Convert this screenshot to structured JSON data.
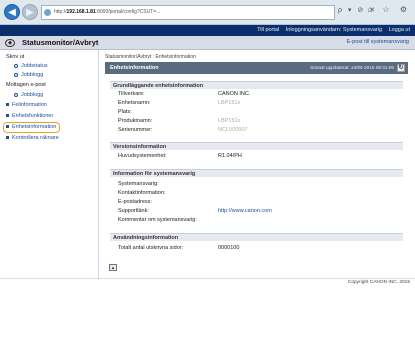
{
  "browser": {
    "url_host": "192.168.1.81",
    "url_rest": ":8000/portal/config?CSUT=...",
    "tools": "ρ ▾ ⊘ ✕",
    "window_tools": "⌂ ☆ ⚙"
  },
  "topbar": {
    "portal": "Till portal",
    "logged_in": "Inloggningsanvändarn: Systemansvarig",
    "logout": "Logga ut"
  },
  "titlebar": {
    "title": "Statusmonitor/Avbryt",
    "mail_link": "E-post till systemansvarig"
  },
  "nav": {
    "section_print": "Skriv ut",
    "job_status": "Jobbstatus",
    "job_log": "Jobblogg",
    "section_email": "Mottagen e-post",
    "email_job_log": "Jobblogg",
    "error_info": "Felinformation",
    "device_functions": "Enhetsfunktioner",
    "device_info": "Enhetsinformation",
    "check_counter": "Kontrollera räknare"
  },
  "main": {
    "breadcrumb": "Statusmonitor/Avbryt : Enhetsinformation",
    "header": "Enhetsinformation",
    "updated": "Senast uppdaterat: 24/06 2015 08:31:06",
    "sections": {
      "basic": "Grundläggande enhetsinformation",
      "version": "Versionsinformation",
      "admin": "Information för systemansvarig",
      "usage": "Användningsinformation"
    },
    "basic_rows": {
      "manufacturer_label": "Tillverkare:",
      "manufacturer_value": "CANON INC.",
      "device_name_label": "Enhetsnamn:",
      "device_name_value": "LBP151x",
      "location_label": "Plats:",
      "product_name_label": "Produktnamn:",
      "product_name_value": "LBP151x",
      "serial_label": "Serienummer:",
      "serial_value": "NCLV00007"
    },
    "version_rows": {
      "main_unit_label": "Huvudsystemenhet:",
      "main_unit_value": "R1.04/PH"
    },
    "admin_rows": {
      "sysadmin_label": "Systemansvarig:",
      "contact_label": "Kontaktinformation:",
      "email_label": "E-postadress:",
      "support_label": "Supportlänk:",
      "support_value": "http://www.canon.com",
      "comment_label": "Kommentar om systemansvarig:"
    },
    "usage_rows": {
      "total_pages_label": "Totalt antal utskrivna sidor:",
      "total_pages_value": "0000100"
    }
  },
  "footer": {
    "copyright": "Copyright CANON INC. 2015"
  }
}
